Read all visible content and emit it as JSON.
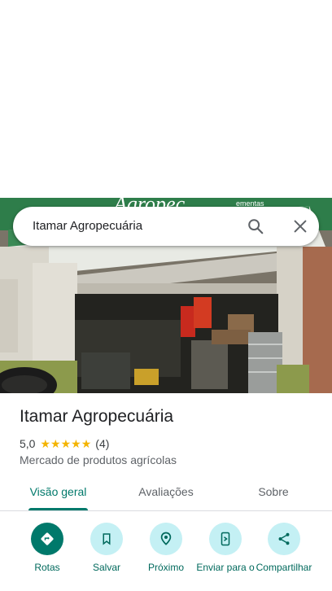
{
  "search": {
    "query": "Itamar Agropecuária"
  },
  "photo": {
    "sign_text": "Agropec",
    "sign_subtext": "ementas"
  },
  "place": {
    "name": "Itamar Agropecuária",
    "rating": "5,0",
    "stars": 5,
    "review_count": "(4)",
    "category": "Mercado de produtos agrícolas"
  },
  "tabs": [
    {
      "label": "Visão geral",
      "active": true
    },
    {
      "label": "Avaliações",
      "active": false
    },
    {
      "label": "Sobre",
      "active": false
    }
  ],
  "actions": [
    {
      "label": "Rotas",
      "icon": "directions-icon"
    },
    {
      "label": "Salvar",
      "icon": "bookmark-icon"
    },
    {
      "label": "Próximo",
      "icon": "nearby-icon"
    },
    {
      "label": "Enviar para o",
      "icon": "send-to-phone-icon"
    },
    {
      "label": "Compartilhar",
      "icon": "share-icon"
    }
  ],
  "colors": {
    "accent": "#00796b",
    "star": "#f4b400",
    "action_bg": "#c4f0f4"
  }
}
